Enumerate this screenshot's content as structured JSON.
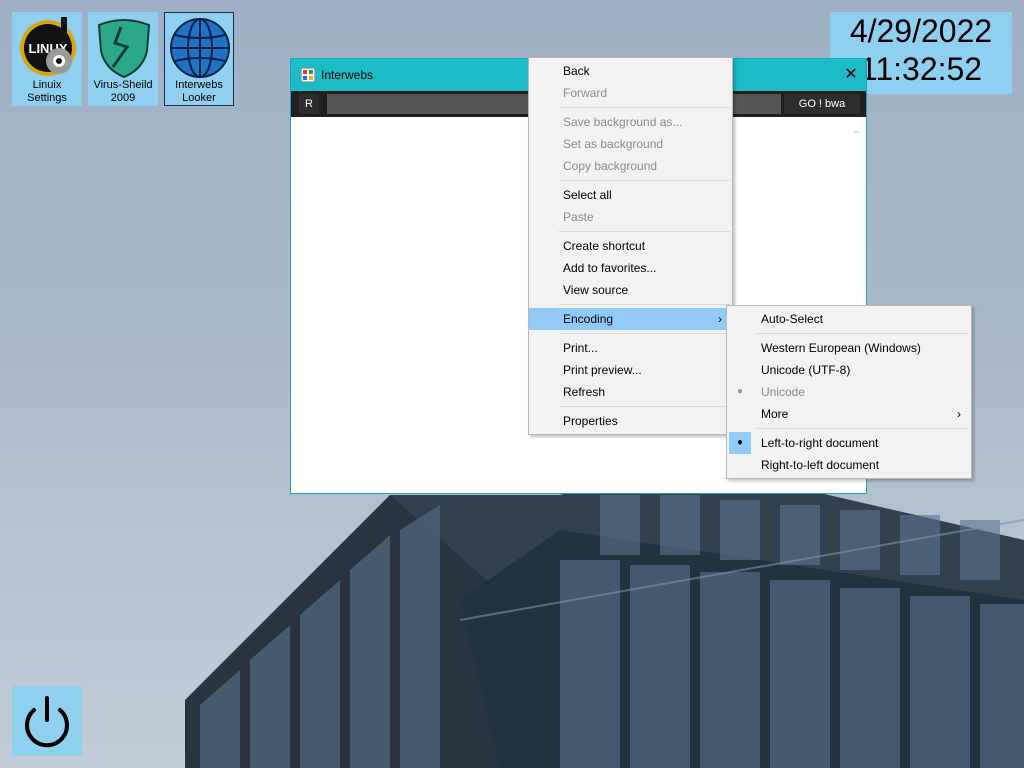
{
  "desktop": {
    "icons": [
      {
        "line1": "Linuix",
        "line2": "Settings"
      },
      {
        "line1": "Virus-Sheild",
        "line2": "2009"
      },
      {
        "line1": "Interwebs",
        "line2": "Looker"
      }
    ],
    "clock": {
      "date": "4/29/2022",
      "time": "11:32:52"
    }
  },
  "window": {
    "title": "Interwebs",
    "close": "✕",
    "toolbar": {
      "refresh_label": "R",
      "url_value": "",
      "go_label": "GO ! bwa"
    }
  },
  "context_menu": {
    "items": [
      {
        "label": "Back",
        "disabled": false
      },
      {
        "label": "Forward",
        "disabled": true
      },
      {
        "label": "Save background as...",
        "disabled": true
      },
      {
        "label": "Set as background",
        "disabled": true
      },
      {
        "label": "Copy background",
        "disabled": true
      },
      {
        "label": "Select all",
        "disabled": false
      },
      {
        "label": "Paste",
        "disabled": true
      },
      {
        "label": "Create shortcut",
        "disabled": false
      },
      {
        "label": "Add to favorites...",
        "disabled": false
      },
      {
        "label": "View source",
        "disabled": false
      },
      {
        "label": "Encoding",
        "disabled": false
      },
      {
        "label": "Print...",
        "disabled": false
      },
      {
        "label": "Print preview...",
        "disabled": false
      },
      {
        "label": "Refresh",
        "disabled": false
      },
      {
        "label": "Properties",
        "disabled": false
      }
    ],
    "submenu_arrow": "›"
  },
  "encoding_menu": {
    "items": [
      {
        "label": "Auto-Select"
      },
      {
        "label": "Western European (Windows)"
      },
      {
        "label": "Unicode (UTF-8)"
      },
      {
        "label": "Unicode"
      },
      {
        "label": "More"
      },
      {
        "label": "Left-to-right document"
      },
      {
        "label": "Right-to-left document"
      }
    ],
    "bullet": "●",
    "submenu_arrow": "›"
  },
  "colors": {
    "icon_bg": "#8fd0f0",
    "titlebar": "#1cbcc6",
    "menu_highlight": "#91c9f7"
  }
}
